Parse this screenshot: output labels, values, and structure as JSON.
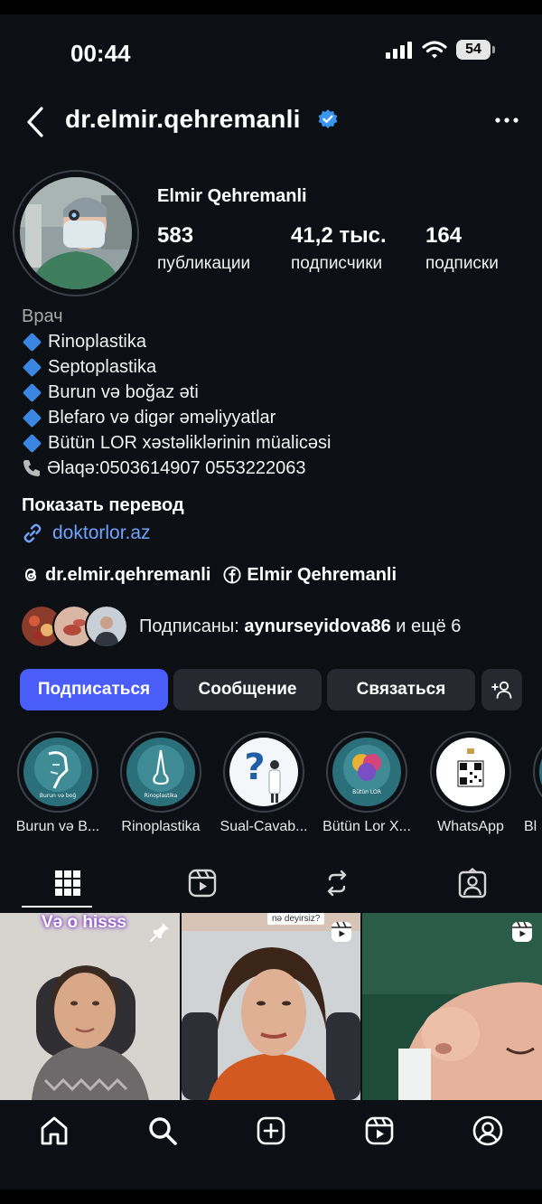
{
  "status_bar": {
    "time": "00:44",
    "battery": "54"
  },
  "header": {
    "username": "dr.elmir.qehremanli"
  },
  "profile": {
    "full_name": "Elmir Qehremanli",
    "stats": [
      {
        "number": "583",
        "label": "публикации"
      },
      {
        "number": "41,2 тыс.",
        "label": "подписчики"
      },
      {
        "number": "164",
        "label": "подписки"
      }
    ],
    "category": "Врач",
    "bio_items": [
      "Rinoplastika",
      "Septoplastika",
      "Burun və boğaz əti",
      "Blefaro və digər əməliyyatlar",
      "Bütün LOR xəstəliklərinin müalicəsi"
    ],
    "contact": "Əlaqə:0503614907 0553222063",
    "translate_label": "Показать перевод",
    "link": "doktorlor.az"
  },
  "socials": {
    "threads": "dr.elmir.qehremanli",
    "facebook": "Elmir Qehremanli"
  },
  "followed_by": {
    "prefix": "Подписаны: ",
    "user": "aynurseyidova86",
    "suffix": " и ещё 6"
  },
  "buttons": {
    "follow": "Подписаться",
    "message": "Сообщение",
    "contact": "Связаться"
  },
  "highlights": [
    {
      "label": "Burun və B...",
      "inner_text": "Burun və boğ"
    },
    {
      "label": "Rinoplastika",
      "inner_text": "Rinoplastika"
    },
    {
      "label": "Sual-Cavab...",
      "inner_text": ""
    },
    {
      "label": "Bütün Lor X...",
      "inner_text": "Bütün LOR"
    },
    {
      "label": "WhatsApp",
      "inner_text": ""
    },
    {
      "label": "Bl",
      "inner_text": ""
    }
  ],
  "posts": [
    {
      "caption": "Və o hisss"
    },
    {
      "caption": "nə deyirsiz?"
    },
    {
      "caption": ""
    }
  ],
  "colors": {
    "accent": "#4a5df9",
    "link": "#6fa3ff",
    "verified": "#3a97f0",
    "background": "#0c0f14"
  }
}
